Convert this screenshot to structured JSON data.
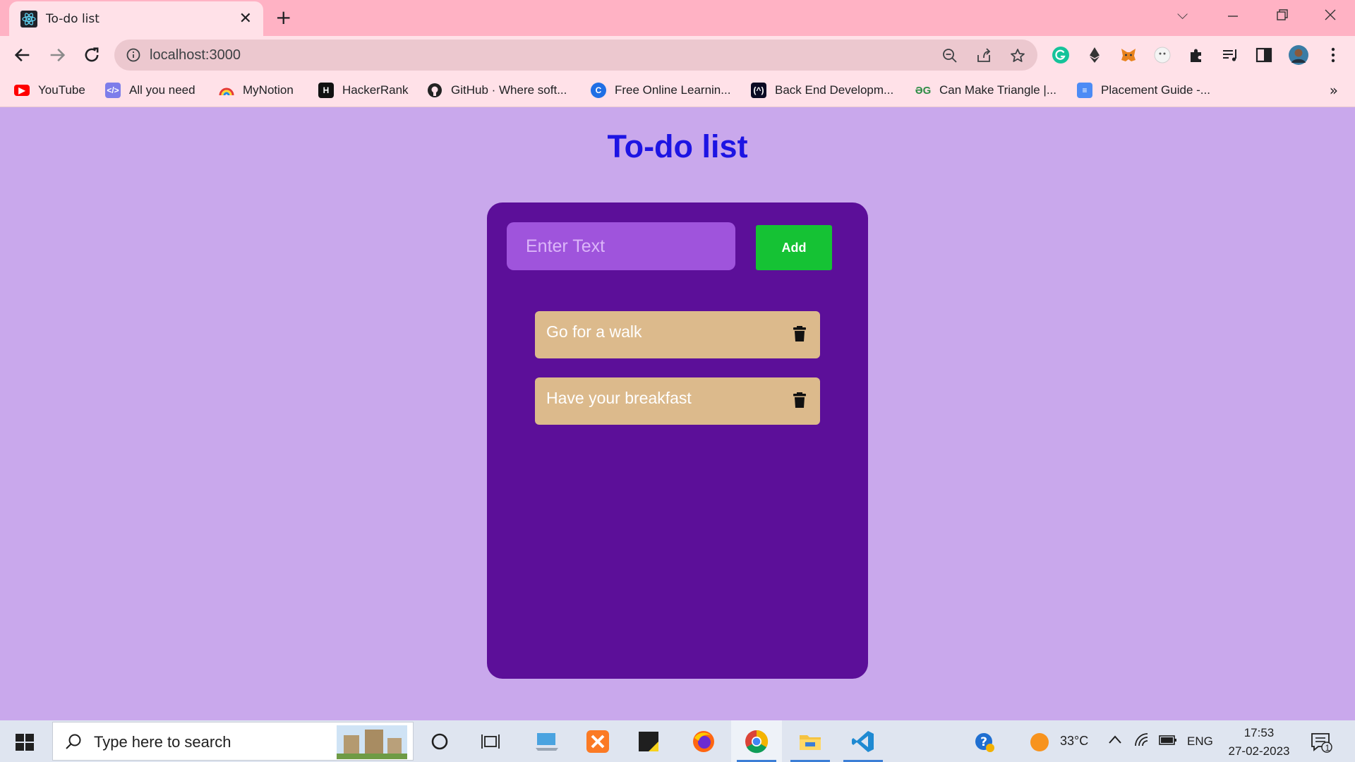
{
  "browser": {
    "tab_title": "To-do list",
    "url": "localhost:3000",
    "bookmarks": [
      {
        "label": "YouTube",
        "icon": "youtube-icon",
        "color": "#ff0000"
      },
      {
        "label": "All you need",
        "icon": "code-icon",
        "color": "#7d7dea"
      },
      {
        "label": "MyNotion",
        "icon": "rainbow-icon",
        "color": "#f0a030"
      },
      {
        "label": "HackerRank",
        "icon": "hackerrank-icon",
        "color": "#111111"
      },
      {
        "label": "GitHub · Where soft...",
        "icon": "github-icon",
        "color": "#222222"
      },
      {
        "label": "Free Online Learnin...",
        "icon": "coursera-icon",
        "color": "#1f6fe5"
      },
      {
        "label": "Back End Developm...",
        "icon": "freecodecamp-icon",
        "color": "#0a0a23"
      },
      {
        "label": "Can Make Triangle |...",
        "icon": "geeksforgeeks-icon",
        "color": "#2f8d46"
      },
      {
        "label": "Placement Guide -...",
        "icon": "docs-icon",
        "color": "#4c8bf5"
      }
    ],
    "more_label": "»"
  },
  "page": {
    "title": "To-do list",
    "input_placeholder": "Enter Text",
    "add_label": "Add",
    "todos": [
      {
        "text": "Go for a walk"
      },
      {
        "text": "Have your breakfast"
      }
    ]
  },
  "taskbar": {
    "search_placeholder": "Type here to search",
    "weather": "33°C",
    "language": "ENG",
    "time": "17:53",
    "date": "27-02-2023",
    "notification_count": "1"
  },
  "colors": {
    "page_bg": "#c9a8ec",
    "title": "#1d14e3",
    "card": "#5c0f99",
    "input": "#9f54dc",
    "add_button": "#15c234",
    "todo_item": "#dcba8c",
    "tab_strip": "#ffb2c4"
  }
}
